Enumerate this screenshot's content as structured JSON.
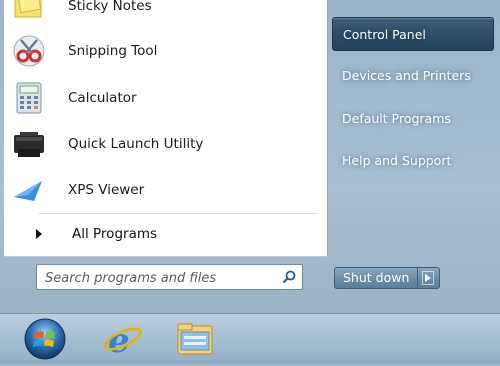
{
  "programs": [
    {
      "label": "Sticky Notes",
      "icon": "sticky-notes-icon"
    },
    {
      "label": "Snipping Tool",
      "icon": "snipping-tool-icon"
    },
    {
      "label": "Calculator",
      "icon": "calculator-icon"
    },
    {
      "label": "Quick Launch Utility",
      "icon": "printer-icon"
    },
    {
      "label": "XPS Viewer",
      "icon": "xps-viewer-icon"
    }
  ],
  "all_programs_label": "All Programs",
  "search": {
    "placeholder": "Search programs and files",
    "value": ""
  },
  "right_items": [
    {
      "label": "Control Panel",
      "highlighted": true
    },
    {
      "label": "Devices and Printers",
      "highlighted": false
    },
    {
      "label": "Default Programs",
      "highlighted": false
    },
    {
      "label": "Help and Support",
      "highlighted": false
    }
  ],
  "shutdown": {
    "label": "Shut down"
  },
  "taskbar": {
    "items": [
      "start-orb-icon",
      "internet-explorer-icon",
      "file-explorer-icon"
    ]
  },
  "colors": {
    "accent": "#2f4d66",
    "glass": "#a8c0d2"
  }
}
